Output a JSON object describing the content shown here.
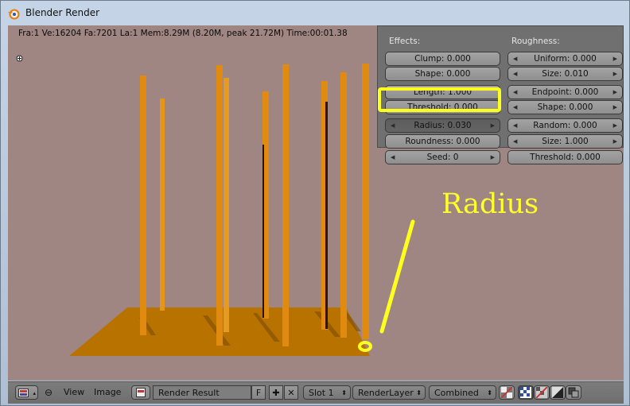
{
  "window": {
    "title": "Blender Render"
  },
  "stats": {
    "text": "Fra:1  Ve:16204 Fa:7201 La:1 Mem:8.29M (8.20M, peak 21.72M) Time:00:01.38"
  },
  "panel": {
    "effects_header": "Effects:",
    "roughness_header": "Roughness:",
    "effects": {
      "clump": "Clump: 0.000",
      "shape1": "Shape: 0.000",
      "length": "Length: 1.000",
      "threshold": "Threshold: 0.000",
      "radius": "Radius: 0.030",
      "roundness": "Roundness: 0.000",
      "seed": "Seed: 0"
    },
    "roughness": {
      "uniform": "Uniform: 0.000",
      "size1": "Size: 0.010",
      "endpoint": "Endpoint: 0.000",
      "shape": "Shape: 0.000",
      "random": "Random: 0.000",
      "size2": "Size: 1.000",
      "threshold": "Threshold: 0.000"
    }
  },
  "annotation": {
    "label": "Radius",
    "color": "#ffff2a"
  },
  "toolbar": {
    "view": "View",
    "image": "Image",
    "image_name": "Render Result",
    "fake_user": "F",
    "slot": "Slot 1",
    "layer": "RenderLayer",
    "pass": "Combined"
  },
  "colors": {
    "background": "#a08683",
    "hair": "#e08a10",
    "ground": "#b87200",
    "panel": "#707070"
  }
}
